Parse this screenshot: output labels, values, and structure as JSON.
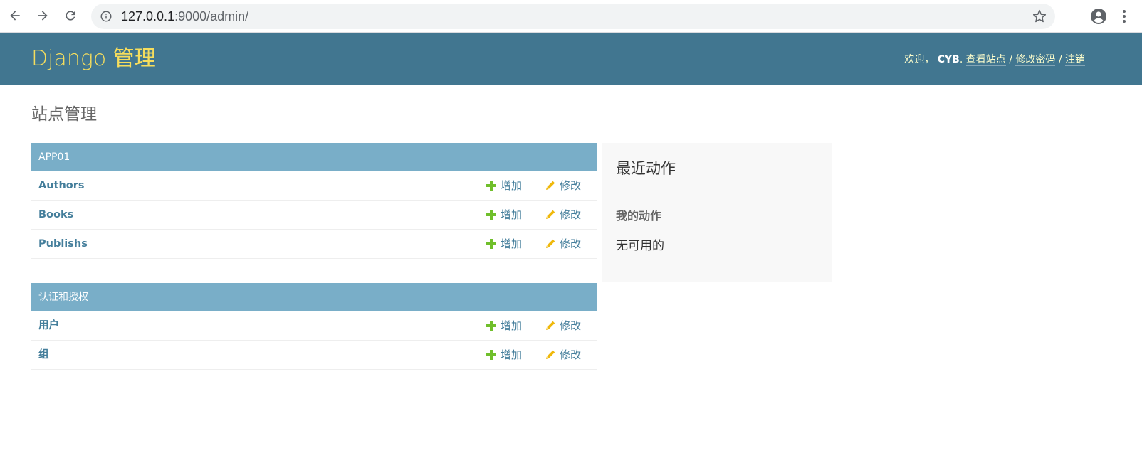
{
  "browser": {
    "url_host": "127.0.0.1",
    "url_rest": ":9000/admin/"
  },
  "header": {
    "branding": "Django 管理",
    "welcome": "欢迎，",
    "username": "CYB",
    "sep_dot": ". ",
    "view_site": "查看站点",
    "sep1": " / ",
    "change_password": "修改密码",
    "sep2": " / ",
    "logout": "注销"
  },
  "page_title": "站点管理",
  "modules": [
    {
      "caption": "APP01",
      "rows": [
        {
          "name": "Authors",
          "add": "增加",
          "change": "修改"
        },
        {
          "name": "Books",
          "add": "增加",
          "change": "修改"
        },
        {
          "name": "Publishs",
          "add": "增加",
          "change": "修改"
        }
      ]
    },
    {
      "caption": "认证和授权",
      "rows": [
        {
          "name": "用户",
          "add": "增加",
          "change": "修改"
        },
        {
          "name": "组",
          "add": "增加",
          "change": "修改"
        }
      ]
    }
  ],
  "recent_actions": {
    "title": "最近动作",
    "subtitle": "我的动作",
    "empty": "无可用的"
  },
  "colors": {
    "header_bg": "#417690",
    "branding": "#f5dd5d",
    "caption_bg": "#79aec8",
    "link": "#447e9b",
    "add_icon": "#70bf2b",
    "change_icon": "#efb80b"
  }
}
